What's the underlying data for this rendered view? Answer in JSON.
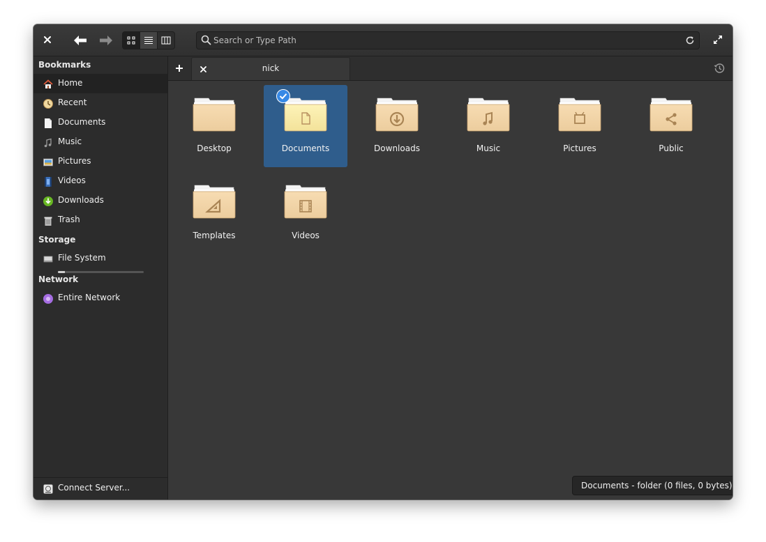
{
  "header": {
    "search_placeholder": "Search or Type Path"
  },
  "tabs": [
    {
      "label": "nick"
    }
  ],
  "sidebar": {
    "sections": {
      "bookmarks": "Bookmarks",
      "storage": "Storage",
      "network": "Network"
    },
    "bookmarks": [
      {
        "label": "Home",
        "icon": "home-icon",
        "selected": true
      },
      {
        "label": "Recent",
        "icon": "recent-icon"
      },
      {
        "label": "Documents",
        "icon": "document-icon"
      },
      {
        "label": "Music",
        "icon": "music-icon"
      },
      {
        "label": "Pictures",
        "icon": "pictures-icon"
      },
      {
        "label": "Videos",
        "icon": "video-icon"
      },
      {
        "label": "Downloads",
        "icon": "download-icon"
      },
      {
        "label": "Trash",
        "icon": "trash-icon"
      }
    ],
    "storage": [
      {
        "label": "File System",
        "icon": "drive-icon",
        "usage_fraction": 0.08
      }
    ],
    "network": [
      {
        "label": "Entire Network",
        "icon": "network-icon"
      }
    ],
    "footer": {
      "label": "Connect Server...",
      "icon": "server-icon"
    }
  },
  "files": [
    {
      "name": "Desktop",
      "emblem": "none",
      "selected": false
    },
    {
      "name": "Documents",
      "emblem": "document-icon",
      "selected": true
    },
    {
      "name": "Downloads",
      "emblem": "download-icon",
      "selected": false
    },
    {
      "name": "Music",
      "emblem": "music-icon",
      "selected": false
    },
    {
      "name": "Pictures",
      "emblem": "pictures-icon",
      "selected": false
    },
    {
      "name": "Public",
      "emblem": "share-icon",
      "selected": false
    },
    {
      "name": "Templates",
      "emblem": "template-icon",
      "selected": false
    },
    {
      "name": "Videos",
      "emblem": "video-icon",
      "selected": false
    }
  ],
  "status": {
    "text": "Documents - folder (0 files, 0 bytes)"
  },
  "colors": {
    "accent": "#2f5d8c",
    "folder_light": "#f7dcb2",
    "folder_dark": "#c8a26f",
    "window_bg": "#383838"
  }
}
